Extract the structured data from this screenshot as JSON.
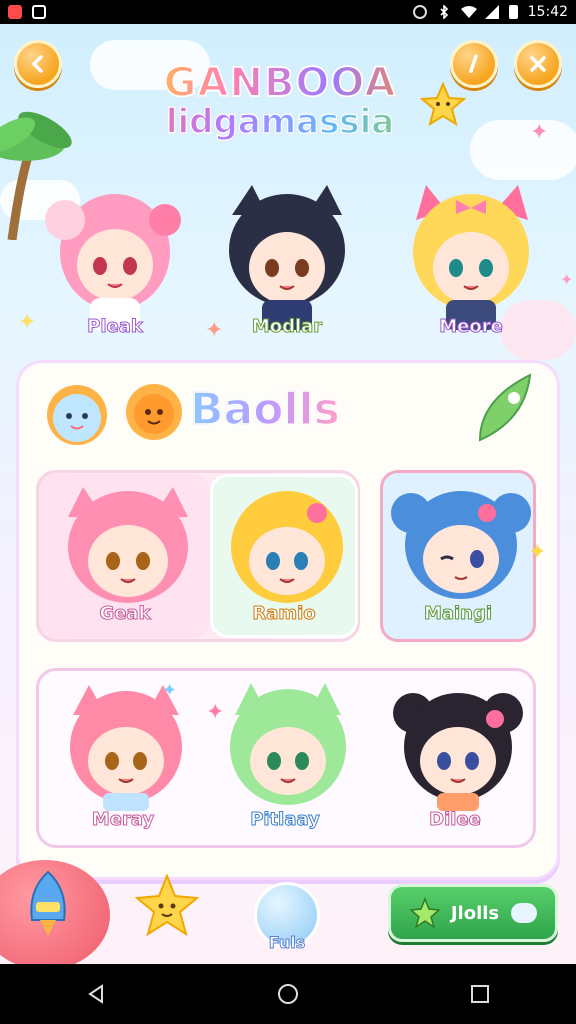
{
  "status_bar": {
    "time": "15:42",
    "icons": [
      "notification-icon",
      "app-icon",
      "sync-icon",
      "bluetooth-icon",
      "wifi-icon",
      "signal-icon",
      "battery-icon"
    ]
  },
  "header": {
    "back_icon": "chevron-left-icon",
    "title_line1": "GANBOOA",
    "title_line2": "lidgamassia",
    "pencil_icon": "pencil-icon",
    "close_icon": "close-icon"
  },
  "top_characters": [
    {
      "name": "Pleak",
      "hair": "#ff9cc0"
    },
    {
      "name": "Modlar",
      "hair": "#2b2f45"
    },
    {
      "name": "Meore",
      "hair": "#ffd85a"
    }
  ],
  "panel": {
    "title": "Baolls",
    "row1": [
      {
        "name": "Geak",
        "hair": "#ff8eb3",
        "bg": "#ffe2ef"
      },
      {
        "name": "Ramio",
        "hair": "#ffcc3d",
        "bg": "#e8f9ef"
      },
      {
        "name": "Maingi",
        "hair": "#4b8fdc",
        "bg": "#dff1ff"
      }
    ],
    "row2": [
      {
        "name": "Meray",
        "hair": "#ff8aa8",
        "bg": "#ffffff"
      },
      {
        "name": "Pitlaay",
        "hair": "#9ee89a",
        "bg": "#ffffff"
      },
      {
        "name": "Dilee",
        "hair": "#2a2430",
        "bg": "#ffffff"
      }
    ]
  },
  "bottom": {
    "rocket_icon": "rocket-icon",
    "star_icon": "star-icon",
    "bubble_label": "Fuls",
    "action_label": "Jlolls",
    "action_icon": "star-icon"
  },
  "colors": {
    "accent_orange": "#f7a51f",
    "panel_border": "#f4dbff",
    "action_green": "#3ab556"
  }
}
